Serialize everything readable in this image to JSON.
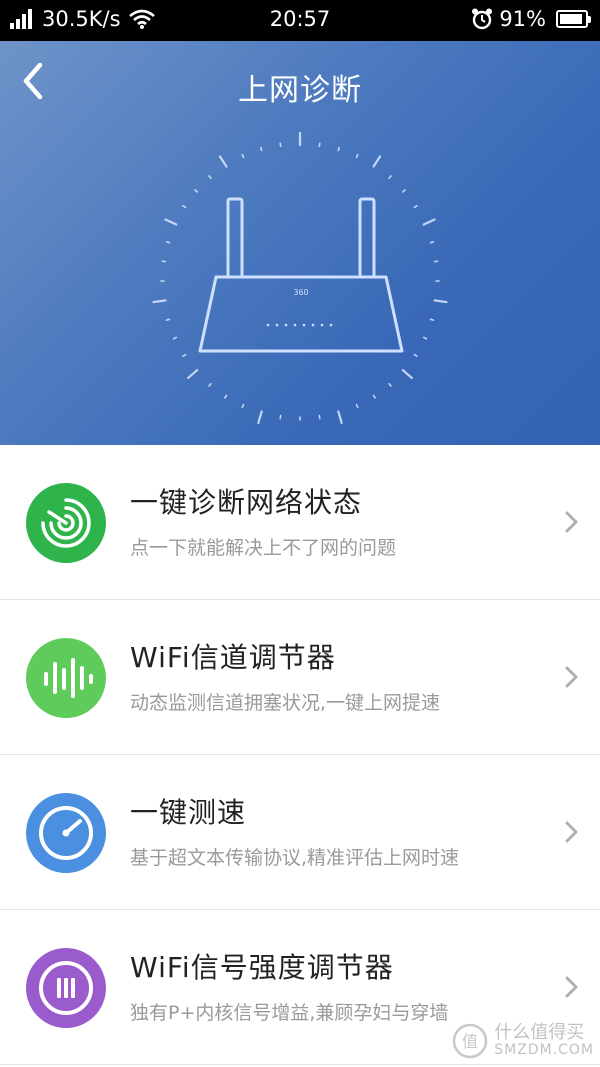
{
  "status_bar": {
    "network_speed": "30.5K/s",
    "time": "20:57",
    "battery_percent": "91%",
    "battery_level": 0.91,
    "icons": [
      "signal-icon",
      "wifi-icon",
      "alarm-icon",
      "battery-icon"
    ]
  },
  "header": {
    "title": "上网诊断",
    "back_icon": "back-arrow-icon"
  },
  "hero": {
    "illustration": "router-icon",
    "router_brand": "360"
  },
  "items": [
    {
      "title": "一键诊断网络状态",
      "subtitle": "点一下就能解决上不了网的问题",
      "icon": "radar-icon",
      "color": "#2fb44b"
    },
    {
      "title": "WiFi信道调节器",
      "subtitle": "动态监测信道拥塞状况,一键上网提速",
      "icon": "sound-bars-icon",
      "color": "#5ecb5a"
    },
    {
      "title": "一键测速",
      "subtitle": "基于超文本传输协议,精准评估上网时速",
      "icon": "speedometer-icon",
      "color": "#4a8fe0"
    },
    {
      "title": "WiFi信号强度调节器",
      "subtitle": "独有P+内核信号增益,兼顾孕妇与穿墙",
      "icon": "signal-strength-icon",
      "color": "#9a5bcc"
    }
  ],
  "watermark": {
    "cn": "什么值得买",
    "en": "SMZDM.COM"
  }
}
